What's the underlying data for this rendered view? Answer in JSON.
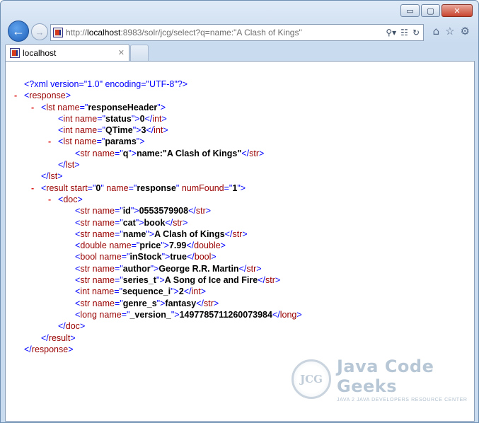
{
  "browser": {
    "controls": {
      "minimize": "▭",
      "maximize": "▢",
      "close": "✕"
    },
    "address": {
      "url_prefix": "http://",
      "host": "localhost",
      "url_rest": ":8983/solr/jcg/select?q=name:\"A Clash of Kings\""
    },
    "tab": {
      "title": "localhost"
    }
  },
  "xml_lines": [
    {
      "indent": 0,
      "collapse": false,
      "parts": [
        [
          "pi",
          "<?xml version=\"1.0\" encoding=\"UTF-8\"?>"
        ]
      ]
    },
    {
      "indent": 1,
      "collapse": true,
      "parts": [
        [
          "b",
          "<"
        ],
        [
          "t",
          "response"
        ],
        [
          "b",
          ">"
        ]
      ]
    },
    {
      "indent": 2,
      "collapse": true,
      "parts": [
        [
          "b",
          "<"
        ],
        [
          "t",
          "lst name"
        ],
        [
          "b",
          "=\""
        ],
        [
          "v",
          "responseHeader"
        ],
        [
          "b",
          "\">"
        ]
      ]
    },
    {
      "indent": 3,
      "collapse": false,
      "parts": [
        [
          "b",
          "<"
        ],
        [
          "t",
          "int name"
        ],
        [
          "b",
          "=\""
        ],
        [
          "v",
          "status"
        ],
        [
          "b",
          "\">"
        ],
        [
          "v",
          "0"
        ],
        [
          "b",
          "</"
        ],
        [
          "t",
          "int"
        ],
        [
          "b",
          ">"
        ]
      ]
    },
    {
      "indent": 3,
      "collapse": false,
      "parts": [
        [
          "b",
          "<"
        ],
        [
          "t",
          "int name"
        ],
        [
          "b",
          "=\""
        ],
        [
          "v",
          "QTime"
        ],
        [
          "b",
          "\">"
        ],
        [
          "v",
          "3"
        ],
        [
          "b",
          "</"
        ],
        [
          "t",
          "int"
        ],
        [
          "b",
          ">"
        ]
      ]
    },
    {
      "indent": 3,
      "collapse": true,
      "parts": [
        [
          "b",
          "<"
        ],
        [
          "t",
          "lst name"
        ],
        [
          "b",
          "=\""
        ],
        [
          "v",
          "params"
        ],
        [
          "b",
          "\">"
        ]
      ]
    },
    {
      "indent": 4,
      "collapse": false,
      "parts": [
        [
          "b",
          "<"
        ],
        [
          "t",
          "str name"
        ],
        [
          "b",
          "=\""
        ],
        [
          "v",
          "q"
        ],
        [
          "b",
          "\">"
        ],
        [
          "v",
          "name:\"A Clash of Kings\""
        ],
        [
          "b",
          "</"
        ],
        [
          "t",
          "str"
        ],
        [
          "b",
          ">"
        ]
      ]
    },
    {
      "indent": 3,
      "collapse": false,
      "parts": [
        [
          "b",
          "</"
        ],
        [
          "t",
          "lst"
        ],
        [
          "b",
          ">"
        ]
      ]
    },
    {
      "indent": 2,
      "collapse": false,
      "parts": [
        [
          "b",
          "</"
        ],
        [
          "t",
          "lst"
        ],
        [
          "b",
          ">"
        ]
      ]
    },
    {
      "indent": 2,
      "collapse": true,
      "parts": [
        [
          "b",
          "<"
        ],
        [
          "t",
          "result start"
        ],
        [
          "b",
          "=\""
        ],
        [
          "v",
          "0"
        ],
        [
          "b",
          "\" "
        ],
        [
          "t",
          "name"
        ],
        [
          "b",
          "=\""
        ],
        [
          "v",
          "response"
        ],
        [
          "b",
          "\" "
        ],
        [
          "t",
          "numFound"
        ],
        [
          "b",
          "=\""
        ],
        [
          "v",
          "1"
        ],
        [
          "b",
          "\">"
        ]
      ]
    },
    {
      "indent": 3,
      "collapse": true,
      "parts": [
        [
          "b",
          "<"
        ],
        [
          "t",
          "doc"
        ],
        [
          "b",
          ">"
        ]
      ]
    },
    {
      "indent": 4,
      "collapse": false,
      "parts": [
        [
          "b",
          "<"
        ],
        [
          "t",
          "str name"
        ],
        [
          "b",
          "=\""
        ],
        [
          "v",
          "id"
        ],
        [
          "b",
          "\">"
        ],
        [
          "v",
          "0553579908"
        ],
        [
          "b",
          "</"
        ],
        [
          "t",
          "str"
        ],
        [
          "b",
          ">"
        ]
      ]
    },
    {
      "indent": 4,
      "collapse": false,
      "parts": [
        [
          "b",
          "<"
        ],
        [
          "t",
          "str name"
        ],
        [
          "b",
          "=\""
        ],
        [
          "v",
          "cat"
        ],
        [
          "b",
          "\">"
        ],
        [
          "v",
          "book"
        ],
        [
          "b",
          "</"
        ],
        [
          "t",
          "str"
        ],
        [
          "b",
          ">"
        ]
      ]
    },
    {
      "indent": 4,
      "collapse": false,
      "parts": [
        [
          "b",
          "<"
        ],
        [
          "t",
          "str name"
        ],
        [
          "b",
          "=\""
        ],
        [
          "v",
          "name"
        ],
        [
          "b",
          "\">"
        ],
        [
          "v",
          "A Clash of Kings"
        ],
        [
          "b",
          "</"
        ],
        [
          "t",
          "str"
        ],
        [
          "b",
          ">"
        ]
      ]
    },
    {
      "indent": 4,
      "collapse": false,
      "parts": [
        [
          "b",
          "<"
        ],
        [
          "t",
          "double name"
        ],
        [
          "b",
          "=\""
        ],
        [
          "v",
          "price"
        ],
        [
          "b",
          "\">"
        ],
        [
          "v",
          "7.99"
        ],
        [
          "b",
          "</"
        ],
        [
          "t",
          "double"
        ],
        [
          "b",
          ">"
        ]
      ]
    },
    {
      "indent": 4,
      "collapse": false,
      "parts": [
        [
          "b",
          "<"
        ],
        [
          "t",
          "bool name"
        ],
        [
          "b",
          "=\""
        ],
        [
          "v",
          "inStock"
        ],
        [
          "b",
          "\">"
        ],
        [
          "v",
          "true"
        ],
        [
          "b",
          "</"
        ],
        [
          "t",
          "bool"
        ],
        [
          "b",
          ">"
        ]
      ]
    },
    {
      "indent": 4,
      "collapse": false,
      "parts": [
        [
          "b",
          "<"
        ],
        [
          "t",
          "str name"
        ],
        [
          "b",
          "=\""
        ],
        [
          "v",
          "author"
        ],
        [
          "b",
          "\">"
        ],
        [
          "v",
          "George R.R. Martin"
        ],
        [
          "b",
          "</"
        ],
        [
          "t",
          "str"
        ],
        [
          "b",
          ">"
        ]
      ]
    },
    {
      "indent": 4,
      "collapse": false,
      "parts": [
        [
          "b",
          "<"
        ],
        [
          "t",
          "str name"
        ],
        [
          "b",
          "=\""
        ],
        [
          "v",
          "series_t"
        ],
        [
          "b",
          "\">"
        ],
        [
          "v",
          "A Song of Ice and Fire"
        ],
        [
          "b",
          "</"
        ],
        [
          "t",
          "str"
        ],
        [
          "b",
          ">"
        ]
      ]
    },
    {
      "indent": 4,
      "collapse": false,
      "parts": [
        [
          "b",
          "<"
        ],
        [
          "t",
          "int name"
        ],
        [
          "b",
          "=\""
        ],
        [
          "v",
          "sequence_i"
        ],
        [
          "b",
          "\">"
        ],
        [
          "v",
          "2"
        ],
        [
          "b",
          "</"
        ],
        [
          "t",
          "int"
        ],
        [
          "b",
          ">"
        ]
      ]
    },
    {
      "indent": 4,
      "collapse": false,
      "parts": [
        [
          "b",
          "<"
        ],
        [
          "t",
          "str name"
        ],
        [
          "b",
          "=\""
        ],
        [
          "v",
          "genre_s"
        ],
        [
          "b",
          "\">"
        ],
        [
          "v",
          "fantasy"
        ],
        [
          "b",
          "</"
        ],
        [
          "t",
          "str"
        ],
        [
          "b",
          ">"
        ]
      ]
    },
    {
      "indent": 4,
      "collapse": false,
      "parts": [
        [
          "b",
          "<"
        ],
        [
          "t",
          "long name"
        ],
        [
          "b",
          "=\""
        ],
        [
          "v",
          "_version_"
        ],
        [
          "b",
          "\">"
        ],
        [
          "v",
          "1497785711260073984"
        ],
        [
          "b",
          "</"
        ],
        [
          "t",
          "long"
        ],
        [
          "b",
          ">"
        ]
      ]
    },
    {
      "indent": 3,
      "collapse": false,
      "parts": [
        [
          "b",
          "</"
        ],
        [
          "t",
          "doc"
        ],
        [
          "b",
          ">"
        ]
      ]
    },
    {
      "indent": 2,
      "collapse": false,
      "parts": [
        [
          "b",
          "</"
        ],
        [
          "t",
          "result"
        ],
        [
          "b",
          ">"
        ]
      ]
    },
    {
      "indent": 1,
      "collapse": false,
      "parts": [
        [
          "b",
          "</"
        ],
        [
          "t",
          "response"
        ],
        [
          "b",
          ">"
        ]
      ]
    }
  ],
  "watermark": {
    "logo_text": "JCG",
    "title": "Java Code Geeks",
    "subtitle": "JAVA 2 JAVA DEVELOPERS RESOURCE CENTER"
  },
  "icons": {
    "back": "back-arrow-icon",
    "forward": "forward-arrow-icon",
    "search": "search-icon",
    "compat": "compatibility-view-icon",
    "refresh": "refresh-icon",
    "home": "home-icon",
    "favorites": "star-icon",
    "tools": "gear-icon",
    "tab_close": "close-icon"
  }
}
